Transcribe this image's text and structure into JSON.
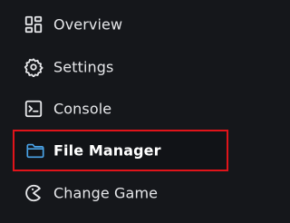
{
  "sidebar": {
    "items": [
      {
        "label": "Overview",
        "icon": "dashboard-icon"
      },
      {
        "label": "Settings",
        "icon": "gear-icon"
      },
      {
        "label": "Console",
        "icon": "terminal-icon"
      },
      {
        "label": "File Manager",
        "icon": "folder-icon",
        "active": true
      },
      {
        "label": "Change Game",
        "icon": "pacman-icon"
      }
    ]
  },
  "colors": {
    "background": "#15171b",
    "text": "#e6e7ea",
    "active_border": "#e0141a",
    "active_icon": "#4aa3e8"
  }
}
